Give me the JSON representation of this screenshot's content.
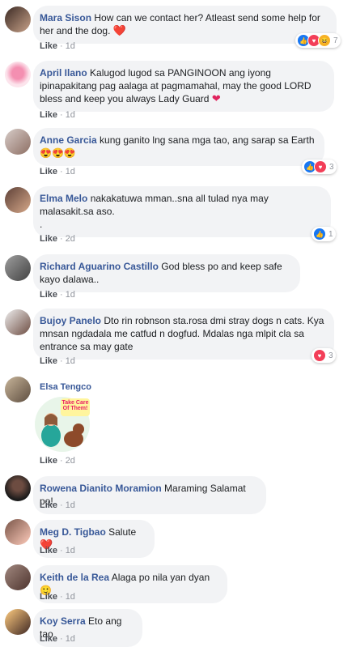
{
  "comments": [
    {
      "name": "Mara Sison",
      "text": "How can we contact her? Atleast send some help for her and the dog.",
      "emoji": "❤️",
      "like": "Like",
      "time": "1d",
      "reactions": "7"
    },
    {
      "name": "April Ilano",
      "text": "Kalugod lugod sa PANGINOON ang iyong ipinapakitang pag aalaga at pagmamahal, may the good LORD bless and keep you always Lady Guard",
      "emoji": "❤️‍🩹",
      "like": "Like",
      "time": "1d"
    },
    {
      "name": "Anne Garcia",
      "text": "kung ganito lng sana mga tao, ang sarap sa Earth",
      "emoji": "😍😍😍",
      "like": "Like",
      "time": "1d",
      "reactions": "3"
    },
    {
      "name": "Elma Melo",
      "text": "nakakatuwa mman..sna all tulad nya may malasakit.sa aso.",
      "extra": ".",
      "like": "Like",
      "time": "2d",
      "reactions": "1"
    },
    {
      "name": "Richard Aguarino Castillo",
      "text": "God bless po and keep safe kayo dalawa..",
      "like": "Like",
      "time": "1d"
    },
    {
      "name": "Bujoy Panelo",
      "text": "Dto rin robnson sta.rosa dmi stray dogs n cats. Kya mnsan ngdadala me catfud n dogfud. Mdalas nga mlpit cla sa entrance sa may gate",
      "like": "Like",
      "time": "1d",
      "reactions": "3"
    },
    {
      "name": "Elsa Tengco",
      "sticker": "Take Care Of Them!",
      "like": "Like",
      "time": "2d"
    },
    {
      "name": "Rowena Dianito Moramion",
      "text": "Maraming Salamat po!",
      "like": "Like",
      "time": "1d"
    },
    {
      "name": "Meg D. Tigbao",
      "text": "Salute",
      "emoji": "❤️",
      "like": "Like",
      "time": "1d"
    },
    {
      "name": "Keith de la Rea",
      "text": "Alaga po nila yan dyan",
      "emoji": "🙂",
      "like": "Like",
      "time": "1d"
    },
    {
      "name": "Koy Serra",
      "text": "Eto ang tao",
      "like": "Like",
      "time": "1d"
    }
  ],
  "dot": "·"
}
